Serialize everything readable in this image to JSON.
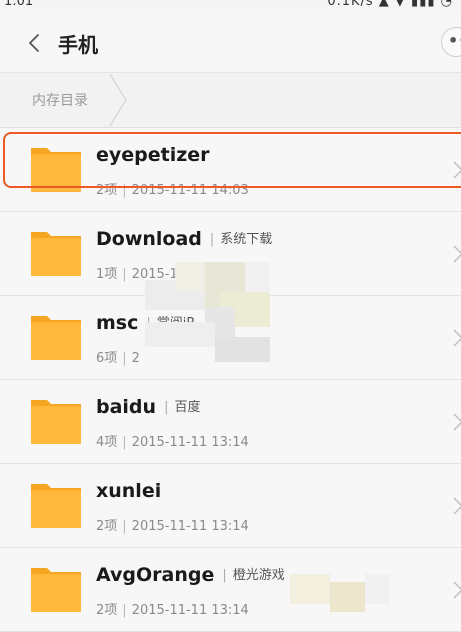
{
  "status_bar": {
    "time": "1:01",
    "indicators": "0.1K/s ▲ ▼ ▮▮▮ ◔"
  },
  "header": {
    "title": "手机",
    "back_icon": "chevron-left-icon",
    "more_icon": "more-dots-icon"
  },
  "breadcrumb": {
    "label": "内存目录"
  },
  "folders": [
    {
      "name": "eyepetizer",
      "tag": "",
      "count": "2项",
      "date": "2015-11-11 14:03",
      "highlighted": true
    },
    {
      "name": "Download",
      "tag": "系统下载",
      "count": "1项",
      "date": "2015-11",
      "highlighted": false
    },
    {
      "name": "msc",
      "tag": "掌阅iR",
      "count": "6项",
      "date": "2",
      "highlighted": false
    },
    {
      "name": "baidu",
      "tag": "百度",
      "count": "4项",
      "date": "2015-11-11 13:14",
      "highlighted": false
    },
    {
      "name": "xunlei",
      "tag": "",
      "count": "2项",
      "date": "2015-11-11 13:14",
      "highlighted": false
    },
    {
      "name": "AvgOrange",
      "tag": "橙光游戏",
      "count": "2项",
      "date": "2015-11-11 13:14",
      "highlighted": false
    }
  ],
  "colors": {
    "folder": "#FFB83C",
    "folder_tab": "#F5A623",
    "highlight_border": "#EC5A26",
    "background": "#F7F7F7"
  }
}
